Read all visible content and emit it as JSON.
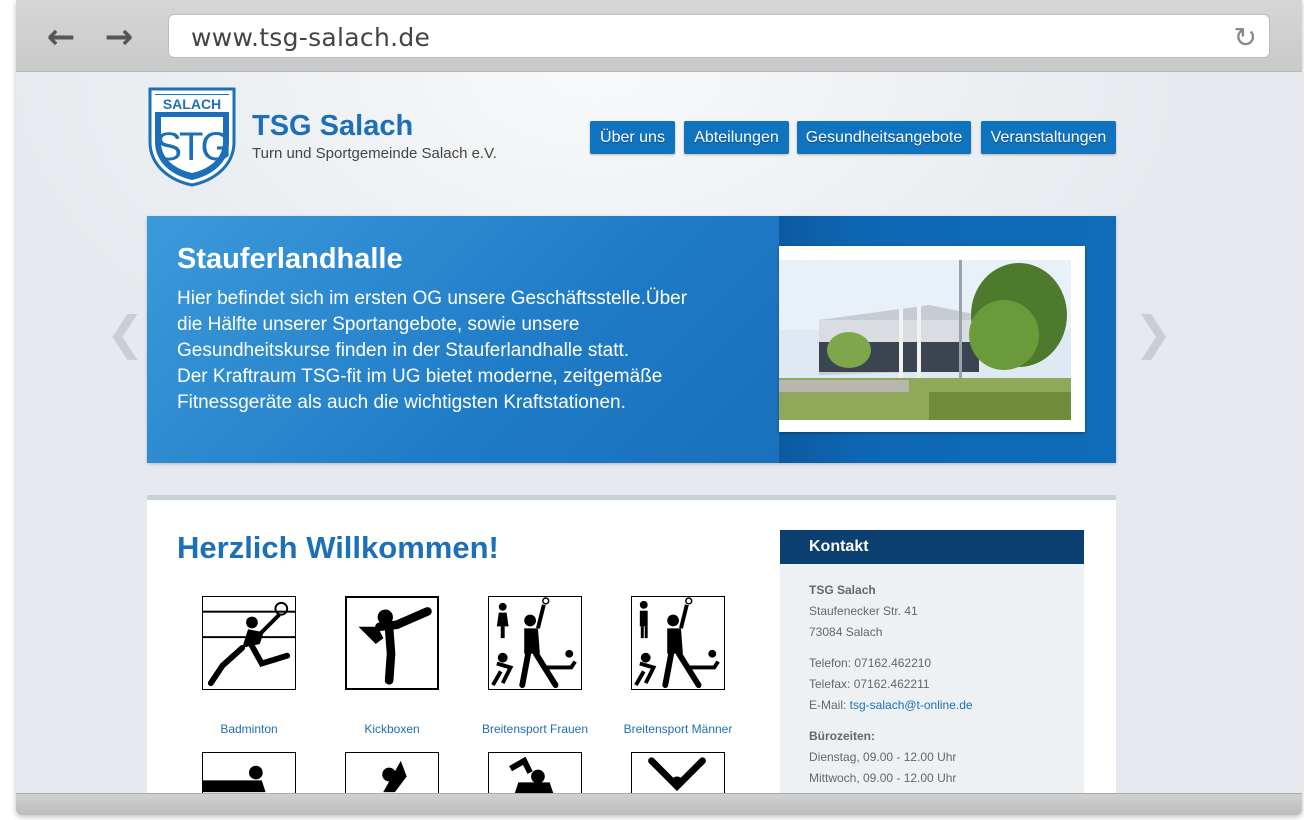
{
  "browser": {
    "url": "www.tsg-salach.de",
    "back_icon": "arrow-left-icon",
    "forward_icon": "arrow-right-icon",
    "reload_icon": "reload-icon"
  },
  "header": {
    "logo_text": "SALACH",
    "logo_letters": "STG",
    "title": "TSG Salach",
    "subtitle": "Turn und Sportgemeinde Salach e.V.",
    "nav": [
      "Über uns",
      "Abteilungen",
      "Gesundheitsangebote",
      "Veranstaltungen"
    ],
    "accent_color": "#0f73be"
  },
  "slider": {
    "title": "Stauferlandhalle",
    "lines": [
      "Hier befindet sich im ersten OG unsere Geschäftsstelle.Über",
      "die Hälfte unserer Sportangebote, sowie unsere",
      "Gesundheitskurse finden in der Stauferlandhalle statt.",
      "Der Kraftraum TSG-fit im UG bietet moderne, zeitgemäße",
      "Fitnessgeräte als auch die wichtigsten Kraftstationen."
    ],
    "prev_symbol": "❮",
    "next_symbol": "❯"
  },
  "main": {
    "welcome": "Herzlich Willkommen!",
    "departments": [
      {
        "label": "Badminton",
        "icon": "badminton-icon"
      },
      {
        "label": "Kickboxen",
        "icon": "kickboxing-icon"
      },
      {
        "label": "Breitensport Frauen",
        "icon": "sports-women-icon"
      },
      {
        "label": "Breitensport Männer",
        "icon": "sports-men-icon"
      }
    ]
  },
  "kontakt": {
    "heading": "Kontakt",
    "name": "TSG Salach",
    "street": "Staufenecker Str. 41",
    "city": "73084 Salach",
    "phone": "Telefon: 07162.462210",
    "fax": "Telefax: 07162.462211",
    "email_label": "E-Mail: ",
    "email": "tsg-salach@t-online.de",
    "hours_heading": "Bürozeiten:",
    "hours": [
      "Dienstag, 09.00 - 12.00 Uhr",
      "Mittwoch, 09.00 - 12.00 Uhr"
    ]
  }
}
